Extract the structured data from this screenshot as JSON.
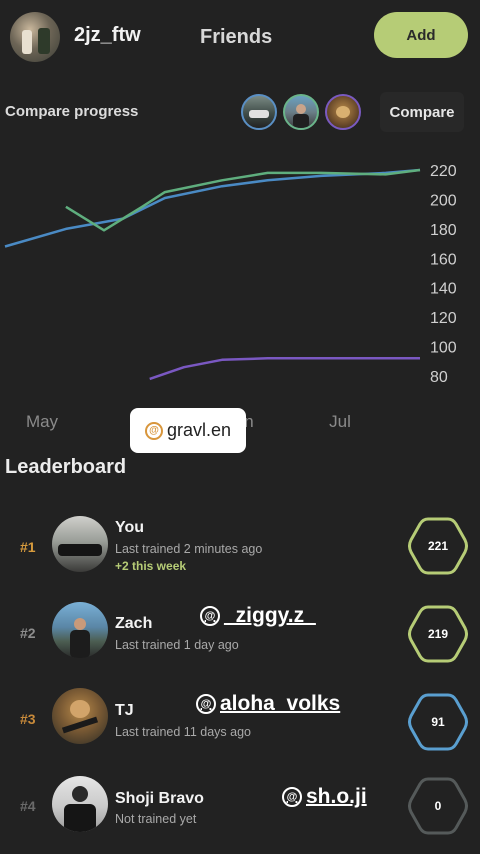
{
  "header": {
    "username": "2jz_ftw",
    "title": "Friends",
    "add_label": "Add"
  },
  "compare": {
    "label": "Compare progress",
    "button_label": "Compare",
    "friend_colors": [
      "#5a8fc4",
      "#6ab48a",
      "#7a5ac0"
    ]
  },
  "chart_data": {
    "type": "line",
    "x_ticks": [
      "May",
      "Jun",
      "Jul"
    ],
    "y_ticks": [
      80,
      100,
      120,
      140,
      160,
      180,
      200,
      220
    ],
    "ylim": [
      75,
      225
    ],
    "grid": false,
    "series": [
      {
        "color": "#4a8ac4",
        "x": [
          "Apr 25",
          "May 10",
          "May 25",
          "Jun 5",
          "Jun 20",
          "Jul 1",
          "Jul 15",
          "Aug 1",
          "Aug 10"
        ],
        "values": [
          168,
          180,
          187,
          201,
          209,
          213,
          216,
          218,
          220
        ]
      },
      {
        "color": "#5fae7e",
        "x": [
          "May 10",
          "May 20",
          "May 30",
          "Jun 5",
          "Jun 20",
          "Jul 1",
          "Jul 15",
          "Aug 1",
          "Aug 10"
        ],
        "values": [
          195,
          179,
          195,
          205,
          213,
          218,
          218,
          217,
          220
        ]
      },
      {
        "color": "#7a58c2",
        "x": [
          "Jun 1",
          "Jun 10",
          "Jun 20",
          "Jul 1",
          "Jul 15",
          "Aug 1",
          "Aug 10"
        ],
        "values": [
          78,
          86,
          91,
          92,
          92,
          92,
          92
        ]
      }
    ]
  },
  "watermarks": {
    "gravl": "gravl.en",
    "row2": "_ziggy.z_",
    "row3": "aloha_volks",
    "row4": "sh.o.ji"
  },
  "leaderboard": {
    "title": "Leaderboard",
    "rows": [
      {
        "rank": "#1",
        "name": "You",
        "sub": "Last trained 2 minutes ago",
        "extra": "+2 this week",
        "score": "221",
        "color": "#b6cc76",
        "rank_color": "#d79b3d"
      },
      {
        "rank": "#2",
        "name": "Zach",
        "sub": "Last trained 1 day ago",
        "extra": "",
        "score": "219",
        "color": "#b6cc76",
        "rank_color": "#8e8e8e"
      },
      {
        "rank": "#3",
        "name": "TJ",
        "sub": "Last trained 11 days ago",
        "extra": "",
        "score": "91",
        "color": "#5a9fd0",
        "rank_color": "#c88a3a"
      },
      {
        "rank": "#4",
        "name": "Shoji Bravo",
        "sub": "Not trained yet",
        "extra": "",
        "score": "0",
        "color": "#555a5a",
        "rank_color": "#6a6a6a"
      }
    ]
  }
}
